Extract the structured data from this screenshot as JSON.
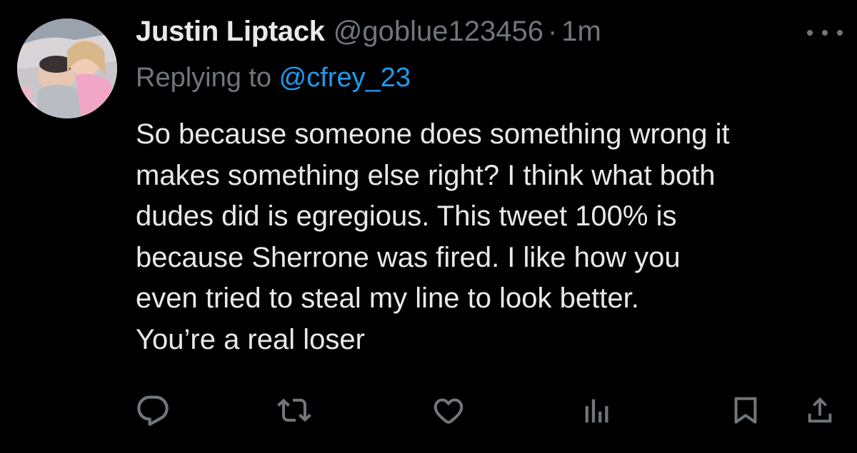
{
  "tweet": {
    "display_name": "Justin Liptack",
    "handle": "@goblue123456",
    "separator": "·",
    "time": "1m",
    "replying_prefix": "Replying to ",
    "replying_to": "@cfrey_23",
    "lines": [
      "So because someone does something wrong it",
      "makes something else right?  I think what both",
      "dudes did is egregious.  This tweet 100% is",
      "because Sherrone was fired.  I like how you",
      "even tried to steal my line to look better.",
      "You’re a real loser"
    ]
  },
  "actions": {
    "reply_icon": "speech-bubble-icon",
    "retweet_icon": "retweet-arrows-icon",
    "like_icon": "heart-icon",
    "views_icon": "bar-chart-icon",
    "bookmark_icon": "bookmark-icon",
    "share_icon": "share-upload-icon"
  },
  "colors": {
    "background": "#000000",
    "primary_text": "#e7e9ea",
    "secondary_text": "#71767b",
    "link": "#1d9bf0"
  }
}
